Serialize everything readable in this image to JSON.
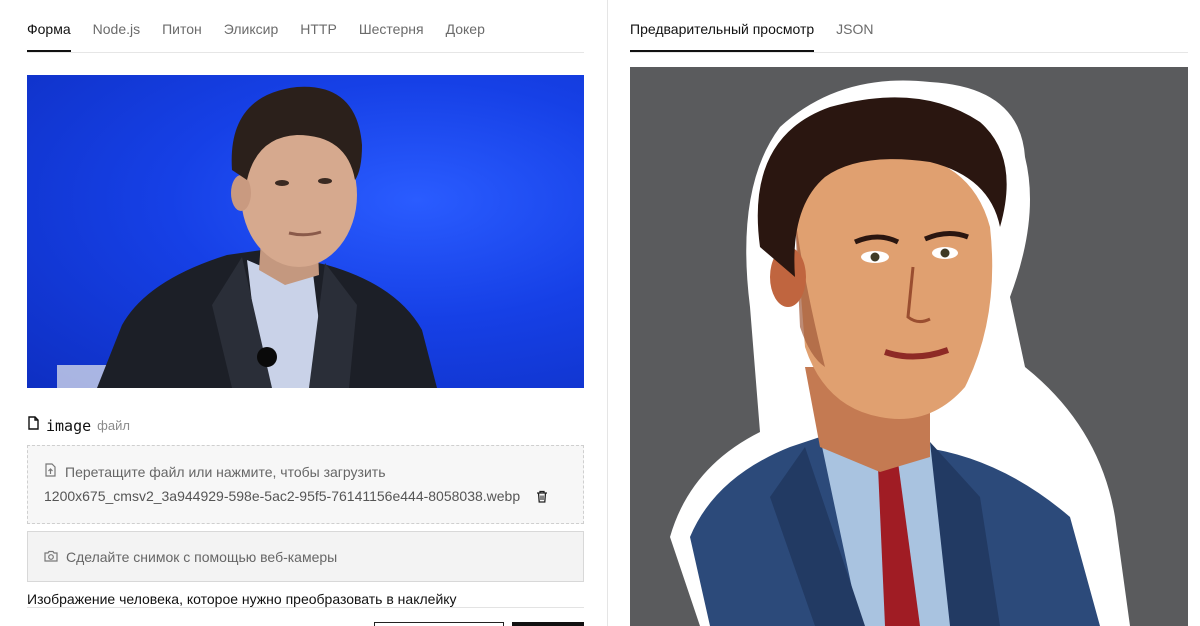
{
  "left_tabs": [
    "Форма",
    "Node.js",
    "Питон",
    "Эликсир",
    "HTTP",
    "Шестерня",
    "Докер"
  ],
  "right_tabs": [
    "Предварительный просмотр",
    "JSON"
  ],
  "field": {
    "name": "image",
    "type": "файл",
    "description": "Изображение человека, которое нужно преобразовать в наклейку"
  },
  "dropzone": {
    "prompt": "Перетащите файл или нажмите, чтобы загрузить",
    "filename": "1200x675_cmsv2_3a944929-598e-5ac2-95f5-76141156e444-8058038.webp"
  },
  "webcam_label": "Сделайте снимок с помощью веб-камеры",
  "icons": {
    "file": "file-icon",
    "upload": "file-upload-icon",
    "trash": "trash-icon",
    "camera": "camera-icon"
  },
  "colors": {
    "input_bg": "#1640e6",
    "output_bg": "#5a5b5d",
    "active_tab": "#111111"
  }
}
